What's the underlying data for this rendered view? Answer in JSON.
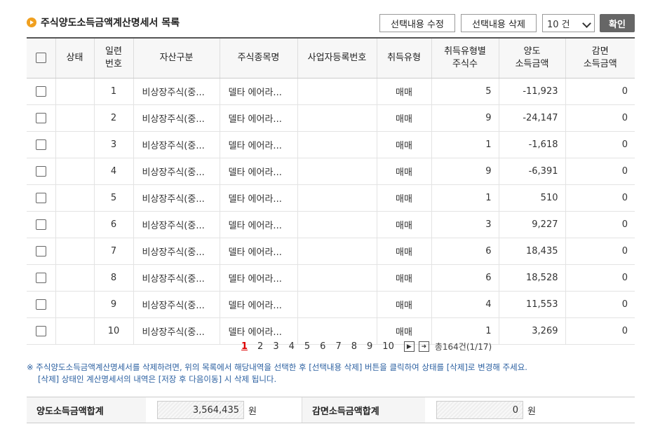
{
  "header": {
    "title": "주식양도소득금액계산명세서 목록",
    "edit_label": "선택내용 수정",
    "delete_label": "선택내용 삭제",
    "page_size": "10 건",
    "confirm_label": "확인"
  },
  "table": {
    "columns": [
      "상태",
      "일련\n번호",
      "자산구분",
      "주식종목명",
      "사업자등록번호",
      "취득유형",
      "취득유형별\n주식수",
      "양도\n소득금액",
      "감면\n소득금액"
    ],
    "rows": [
      {
        "status": "",
        "no": "1",
        "asset": "비상장주식(중...",
        "stock": "델타 에어라...",
        "biz": "",
        "type": "매매",
        "shares": "5",
        "gain": "-11,923",
        "exempt": "0"
      },
      {
        "status": "",
        "no": "2",
        "asset": "비상장주식(중...",
        "stock": "델타 에어라...",
        "biz": "",
        "type": "매매",
        "shares": "9",
        "gain": "-24,147",
        "exempt": "0"
      },
      {
        "status": "",
        "no": "3",
        "asset": "비상장주식(중...",
        "stock": "델타 에어라...",
        "biz": "",
        "type": "매매",
        "shares": "1",
        "gain": "-1,618",
        "exempt": "0"
      },
      {
        "status": "",
        "no": "4",
        "asset": "비상장주식(중...",
        "stock": "델타 에어라...",
        "biz": "",
        "type": "매매",
        "shares": "9",
        "gain": "-6,391",
        "exempt": "0"
      },
      {
        "status": "",
        "no": "5",
        "asset": "비상장주식(중...",
        "stock": "델타 에어라...",
        "biz": "",
        "type": "매매",
        "shares": "1",
        "gain": "510",
        "exempt": "0"
      },
      {
        "status": "",
        "no": "6",
        "asset": "비상장주식(중...",
        "stock": "델타 에어라...",
        "biz": "",
        "type": "매매",
        "shares": "3",
        "gain": "9,227",
        "exempt": "0"
      },
      {
        "status": "",
        "no": "7",
        "asset": "비상장주식(중...",
        "stock": "델타 에어라...",
        "biz": "",
        "type": "매매",
        "shares": "6",
        "gain": "18,435",
        "exempt": "0"
      },
      {
        "status": "",
        "no": "8",
        "asset": "비상장주식(중...",
        "stock": "델타 에어라...",
        "biz": "",
        "type": "매매",
        "shares": "6",
        "gain": "18,528",
        "exempt": "0"
      },
      {
        "status": "",
        "no": "9",
        "asset": "비상장주식(중...",
        "stock": "델타 에어라...",
        "biz": "",
        "type": "매매",
        "shares": "4",
        "gain": "11,553",
        "exempt": "0"
      },
      {
        "status": "",
        "no": "10",
        "asset": "비상장주식(중...",
        "stock": "델타 에어라...",
        "biz": "",
        "type": "매매",
        "shares": "1",
        "gain": "3,269",
        "exempt": "0"
      }
    ]
  },
  "pager": {
    "pages": [
      "1",
      "2",
      "3",
      "4",
      "5",
      "6",
      "7",
      "8",
      "9",
      "10"
    ],
    "current": "1",
    "next_icon": "▶",
    "last_icon": "➜",
    "total": "총164건(1/17)"
  },
  "note": {
    "line1": "※ 주식양도소득금액계산명세서를 삭제하려면, 위의 목록에서 해당내역을 선택한 후 [선택내용 삭제] 버튼을 클릭하여 상태를 [삭제]로 변경해 주세요.",
    "line2": "[삭제] 상태인 계산명세서의 내역은 [저장 후 다음이동] 시 삭제 됩니다."
  },
  "summary": {
    "gain_label": "양도소득금액합계",
    "gain_value": "3,564,435",
    "exempt_label": "감면소득금액합계",
    "exempt_value": "0",
    "unit": "원"
  }
}
